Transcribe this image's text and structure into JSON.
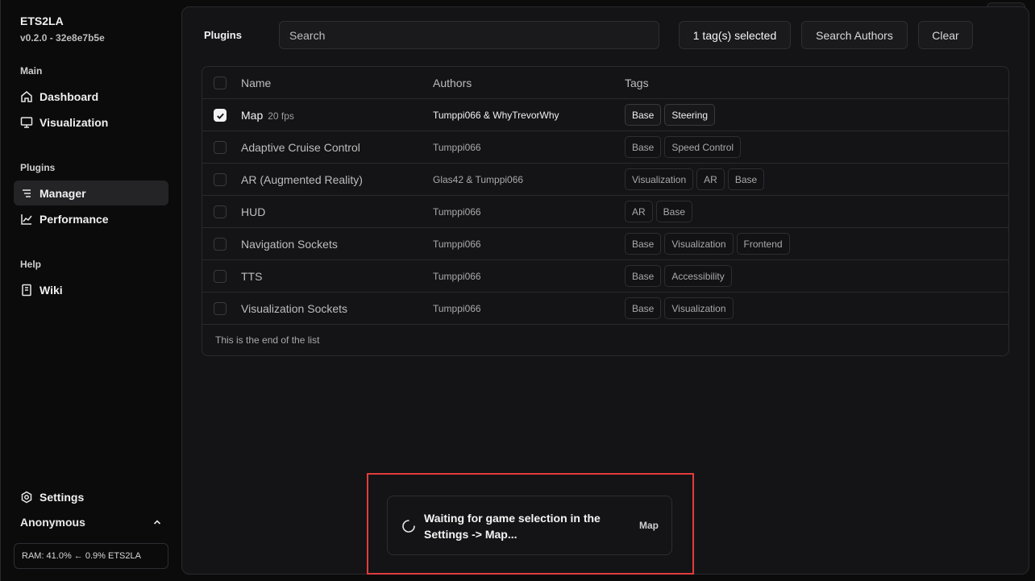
{
  "app": {
    "title": "ETS2LA",
    "version": "v0.2.0 - 32e8e7b5e"
  },
  "sidebar": {
    "sections": [
      {
        "label": "Main",
        "items": [
          {
            "label": "Dashboard",
            "icon": "home-icon"
          },
          {
            "label": "Visualization",
            "icon": "monitor-icon"
          }
        ]
      },
      {
        "label": "Plugins",
        "items": [
          {
            "label": "Manager",
            "icon": "list-icon",
            "active": true
          },
          {
            "label": "Performance",
            "icon": "chart-icon"
          }
        ]
      },
      {
        "label": "Help",
        "items": [
          {
            "label": "Wiki",
            "icon": "book-icon"
          }
        ]
      }
    ],
    "settings_label": "Settings",
    "user_label": "Anonymous",
    "ram_text": "RAM: 41.0% ← 0.9% ETS2LA"
  },
  "toolbar": {
    "title": "Plugins",
    "search_placeholder": "Search",
    "tags_button": "1 tag(s) selected",
    "authors_button": "Search Authors",
    "clear_button": "Clear"
  },
  "table": {
    "headers": {
      "name": "Name",
      "authors": "Authors",
      "tags": "Tags"
    },
    "rows": [
      {
        "name": "Map",
        "fps": "20 fps",
        "authors": "Tumppi066 & WhyTrevorWhy",
        "tags": [
          "Base",
          "Steering"
        ],
        "selected": true
      },
      {
        "name": "Adaptive Cruise Control",
        "authors": "Tumppi066",
        "tags": [
          "Base",
          "Speed Control"
        ],
        "selected": false
      },
      {
        "name": "AR (Augmented Reality)",
        "authors": "Glas42 & Tumppi066",
        "tags": [
          "Visualization",
          "AR",
          "Base"
        ],
        "selected": false
      },
      {
        "name": "HUD",
        "authors": "Tumppi066",
        "tags": [
          "AR",
          "Base"
        ],
        "selected": false
      },
      {
        "name": "Navigation Sockets",
        "authors": "Tumppi066",
        "tags": [
          "Base",
          "Visualization",
          "Frontend"
        ],
        "selected": false
      },
      {
        "name": "TTS",
        "authors": "Tumppi066",
        "tags": [
          "Base",
          "Accessibility"
        ],
        "selected": false
      },
      {
        "name": "Visualization Sockets",
        "authors": "Tumppi066",
        "tags": [
          "Base",
          "Visualization"
        ],
        "selected": false
      }
    ],
    "end_note": "This is the end of the list"
  },
  "toast": {
    "message": "Waiting for game selection in the Settings -> Map...",
    "source": "Map"
  },
  "colors": {
    "highlight": "#e23c3c",
    "dot_green": "#2fb84a",
    "dot_yellow": "#e3b21f",
    "dot_red": "#e5483e"
  }
}
